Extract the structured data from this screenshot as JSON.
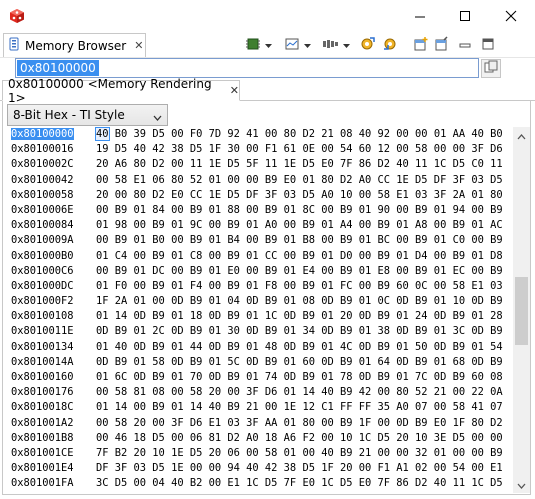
{
  "view": {
    "tab_label": "Memory Browser",
    "tab_close": "✕"
  },
  "address": {
    "value": "0x80100000",
    "go_icon": "go-icon"
  },
  "rendering": {
    "tab_label": "0x80100000 <Memory Rendering 1>",
    "tab_close": "✕",
    "format": "8-Bit Hex - TI Style"
  },
  "colors": {
    "selection": "#3a8ff0",
    "app_icon": "#e0281e"
  },
  "memory": {
    "rows": [
      {
        "addr": "0x80100000",
        "first": "40",
        "bytes": "B0 39 D5 00 F0 7D 92 41 00 80 D2 21 08 40 92 00 00 01 AA 40 B0"
      },
      {
        "addr": "0x80100016",
        "bytes": "19 D5 40 42 38 D5 1F 30 00 F1 61 0E 00 54 60 12 00 58 00 00 3F D6"
      },
      {
        "addr": "0x8010002C",
        "bytes": "20 A6 80 D2 00 11 1E D5 5F 11 1E D5 E0 7F 86 D2 40 11 1C D5 C0 11"
      },
      {
        "addr": "0x80100042",
        "bytes": "00 58 E1 06 80 52 01 00 00 B9 E0 01 80 D2 A0 CC 1E D5 DF 3F 03 D5"
      },
      {
        "addr": "0x80100058",
        "bytes": "20 00 80 D2 E0 CC 1E D5 DF 3F 03 D5 A0 10 00 58 E1 03 3F 2A 01 80"
      },
      {
        "addr": "0x8010006E",
        "bytes": "00 B9 01 84 00 B9 01 88 00 B9 01 8C 00 B9 01 90 00 B9 01 94 00 B9"
      },
      {
        "addr": "0x80100084",
        "bytes": "01 98 00 B9 01 9C 00 B9 01 A0 00 B9 01 A4 00 B9 01 A8 00 B9 01 AC"
      },
      {
        "addr": "0x8010009A",
        "bytes": "00 B9 01 B0 00 B9 01 B4 00 B9 01 B8 00 B9 01 BC 00 B9 01 C0 00 B9"
      },
      {
        "addr": "0x801000B0",
        "bytes": "01 C4 00 B9 01 C8 00 B9 01 CC 00 B9 01 D0 00 B9 01 D4 00 B9 01 D8"
      },
      {
        "addr": "0x801000C6",
        "bytes": "00 B9 01 DC 00 B9 01 E0 00 B9 01 E4 00 B9 01 E8 00 B9 01 EC 00 B9"
      },
      {
        "addr": "0x801000DC",
        "bytes": "01 F0 00 B9 01 F4 00 B9 01 F8 00 B9 01 FC 00 B9 60 0C 00 58 E1 03"
      },
      {
        "addr": "0x801000F2",
        "bytes": "1F 2A 01 00 0D B9 01 04 0D B9 01 08 0D B9 01 0C 0D B9 01 10 0D B9"
      },
      {
        "addr": "0x80100108",
        "bytes": "01 14 0D B9 01 18 0D B9 01 1C 0D B9 01 20 0D B9 01 24 0D B9 01 28"
      },
      {
        "addr": "0x8010011E",
        "bytes": "0D B9 01 2C 0D B9 01 30 0D B9 01 34 0D B9 01 38 0D B9 01 3C 0D B9"
      },
      {
        "addr": "0x80100134",
        "bytes": "01 40 0D B9 01 44 0D B9 01 48 0D B9 01 4C 0D B9 01 50 0D B9 01 54"
      },
      {
        "addr": "0x8010014A",
        "bytes": "0D B9 01 58 0D B9 01 5C 0D B9 01 60 0D B9 01 64 0D B9 01 68 0D B9"
      },
      {
        "addr": "0x80100160",
        "bytes": "01 6C 0D B9 01 70 0D B9 01 74 0D B9 01 78 0D B9 01 7C 0D B9 60 08"
      },
      {
        "addr": "0x80100176",
        "bytes": "00 58 81 08 00 58 20 00 3F D6 01 14 40 B9 42 00 80 52 21 00 22 0A"
      },
      {
        "addr": "0x8010018C",
        "bytes": "01 14 00 B9 01 14 40 B9 21 00 1E 12 C1 FF FF 35 A0 07 00 58 41 07"
      },
      {
        "addr": "0x801001A2",
        "bytes": "00 58 20 00 3F D6 E1 03 3F AA 01 80 00 B9 1F 00 0D B9 E0 1F 80 D2"
      },
      {
        "addr": "0x801001B8",
        "bytes": "00 46 18 D5 00 06 81 D2 A0 18 A6 F2 00 10 1C D5 20 10 3E D5 00 00"
      },
      {
        "addr": "0x801001CE",
        "bytes": "7F B2 20 10 1E D5 20 06 00 58 01 00 40 B9 21 00 00 32 01 00 00 B9"
      },
      {
        "addr": "0x801001E4",
        "bytes": "DF 3F 03 D5 1E 00 00 94 40 42 38 D5 1F 20 00 F1 A1 02 00 54 00 E1"
      },
      {
        "addr": "0x801001FA",
        "bytes": "3C D5 00 04 40 B2 00 E1 1C D5 7F E0 1C D5 E0 7F 86 D2 40 11 1C D5"
      }
    ]
  }
}
